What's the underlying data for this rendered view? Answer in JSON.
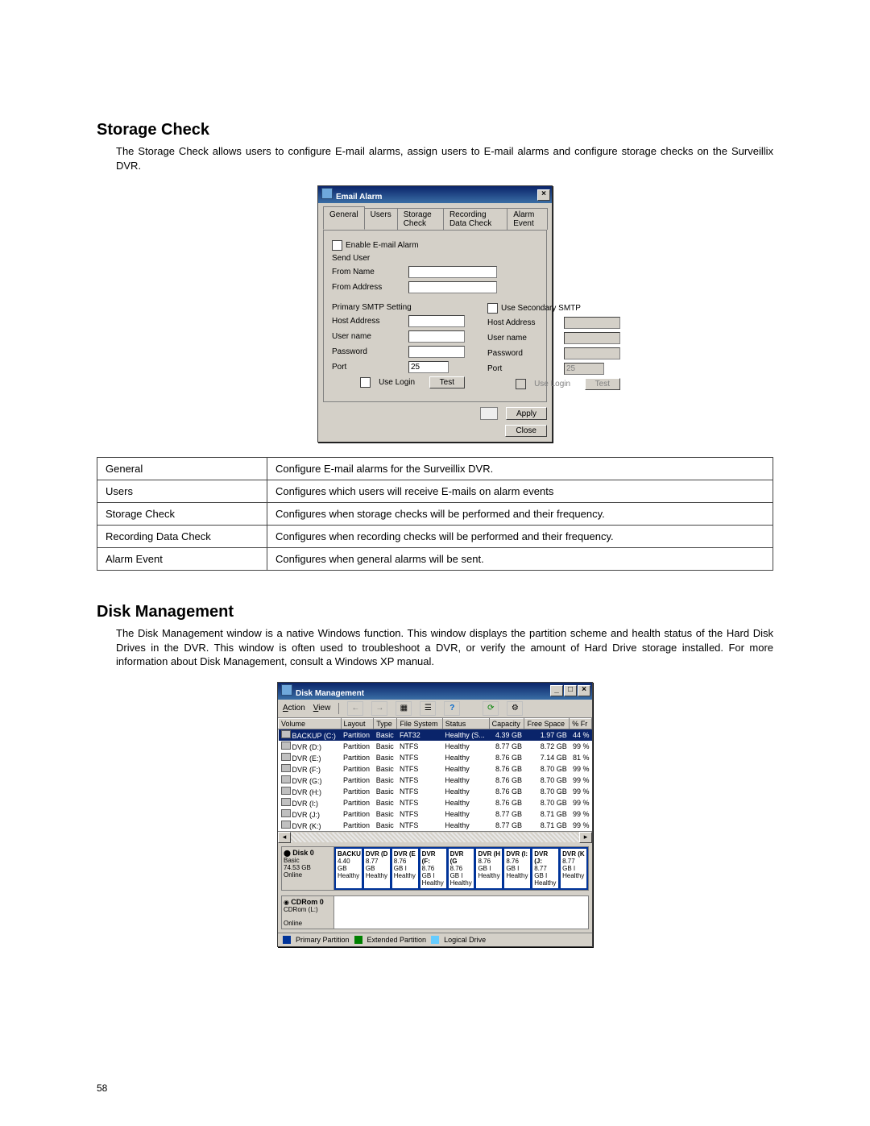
{
  "pageNumber": "58",
  "storageCheck": {
    "heading": "Storage Check",
    "intro": "The Storage Check allows users to configure E-mail alarms, assign users to E-mail alarms and configure storage checks on the Surveillix DVR.",
    "dialog": {
      "title": "Email Alarm",
      "tabs": [
        "General",
        "Users",
        "Storage Check",
        "Recording Data Check",
        "Alarm Event"
      ],
      "enableEmailAlarm": "Enable E-mail Alarm",
      "sendUser": "Send User",
      "fromName": "From Name",
      "fromAddress": "From Address",
      "primary": {
        "heading": "Primary SMTP Setting",
        "host": "Host Address",
        "user": "User name",
        "pass": "Password",
        "port": "Port",
        "portValue": "25",
        "useLogin": "Use Login",
        "test": "Test"
      },
      "secondary": {
        "use": "Use Secondary SMTP",
        "host": "Host Address",
        "user": "User name",
        "pass": "Password",
        "port": "Port",
        "portValue": "25",
        "useLogin": "Use Login",
        "test": "Test"
      },
      "apply": "Apply",
      "close": "Close"
    },
    "definitions": [
      {
        "term": "General",
        "desc": "Configure E-mail alarms for the Surveillix DVR."
      },
      {
        "term": "Users",
        "desc": "Configures which users will receive E-mails on alarm events"
      },
      {
        "term": "Storage Check",
        "desc": "Configures when storage checks will be performed and their frequency."
      },
      {
        "term": "Recording Data Check",
        "desc": "Configures when recording checks will be performed and their frequency."
      },
      {
        "term": "Alarm Event",
        "desc": "Configures when general alarms will be sent."
      }
    ]
  },
  "diskManagement": {
    "heading": "Disk Management",
    "intro": "The Disk Management window is a native Windows function. This window displays the partition scheme and health status of the Hard Disk Drives in the DVR. This window is often used to troubleshoot a DVR, or verify the amount of Hard Drive storage installed. For more information about Disk Management, consult a Windows XP manual.",
    "window": {
      "title": "Disk Management",
      "menu": {
        "action": "Action",
        "view": "View"
      },
      "columns": [
        "Volume",
        "Layout",
        "Type",
        "File System",
        "Status",
        "Capacity",
        "Free Space",
        "% Fr"
      ],
      "rows": [
        {
          "vol": "BACKUP (C:)",
          "layout": "Partition",
          "type": "Basic",
          "fs": "FAT32",
          "status": "Healthy (S...",
          "cap": "4.39 GB",
          "free": "1.97 GB",
          "pct": "44 %",
          "sel": true
        },
        {
          "vol": "DVR (D:)",
          "layout": "Partition",
          "type": "Basic",
          "fs": "NTFS",
          "status": "Healthy",
          "cap": "8.77 GB",
          "free": "8.72 GB",
          "pct": "99 %"
        },
        {
          "vol": "DVR (E:)",
          "layout": "Partition",
          "type": "Basic",
          "fs": "NTFS",
          "status": "Healthy",
          "cap": "8.76 GB",
          "free": "7.14 GB",
          "pct": "81 %"
        },
        {
          "vol": "DVR (F:)",
          "layout": "Partition",
          "type": "Basic",
          "fs": "NTFS",
          "status": "Healthy",
          "cap": "8.76 GB",
          "free": "8.70 GB",
          "pct": "99 %"
        },
        {
          "vol": "DVR (G:)",
          "layout": "Partition",
          "type": "Basic",
          "fs": "NTFS",
          "status": "Healthy",
          "cap": "8.76 GB",
          "free": "8.70 GB",
          "pct": "99 %"
        },
        {
          "vol": "DVR (H:)",
          "layout": "Partition",
          "type": "Basic",
          "fs": "NTFS",
          "status": "Healthy",
          "cap": "8.76 GB",
          "free": "8.70 GB",
          "pct": "99 %"
        },
        {
          "vol": "DVR (I:)",
          "layout": "Partition",
          "type": "Basic",
          "fs": "NTFS",
          "status": "Healthy",
          "cap": "8.76 GB",
          "free": "8.70 GB",
          "pct": "99 %"
        },
        {
          "vol": "DVR (J:)",
          "layout": "Partition",
          "type": "Basic",
          "fs": "NTFS",
          "status": "Healthy",
          "cap": "8.77 GB",
          "free": "8.71 GB",
          "pct": "99 %"
        },
        {
          "vol": "DVR (K:)",
          "layout": "Partition",
          "type": "Basic",
          "fs": "NTFS",
          "status": "Healthy",
          "cap": "8.77 GB",
          "free": "8.71 GB",
          "pct": "99 %"
        }
      ],
      "disk0": {
        "name": "Disk 0",
        "type": "Basic",
        "size": "74.53 GB",
        "state": "Online",
        "parts": [
          {
            "n": "BACKU",
            "s": "4.40 GB",
            "st": "Healthy"
          },
          {
            "n": "DVR (D",
            "s": "8.77 GB",
            "st": "Healthy"
          },
          {
            "n": "DVR (E",
            "s": "8.76 GB I",
            "st": "Healthy"
          },
          {
            "n": "DVR (F:",
            "s": "8.76 GB I",
            "st": "Healthy"
          },
          {
            "n": "DVR (G",
            "s": "8.76 GB I",
            "st": "Healthy"
          },
          {
            "n": "DVR (H",
            "s": "8.76 GB I",
            "st": "Healthy"
          },
          {
            "n": "DVR (I:",
            "s": "8.76 GB I",
            "st": "Healthy"
          },
          {
            "n": "DVR (J:",
            "s": "8.77 GB I",
            "st": "Healthy"
          },
          {
            "n": "DVR (K",
            "s": "8.77 GB I",
            "st": "Healthy"
          }
        ]
      },
      "cdrom": {
        "name": "CDRom 0",
        "drive": "CDRom (L:)",
        "state": "Online"
      },
      "legend": {
        "primary": "Primary Partition",
        "extended": "Extended Partition",
        "logical": "Logical Drive"
      }
    }
  }
}
